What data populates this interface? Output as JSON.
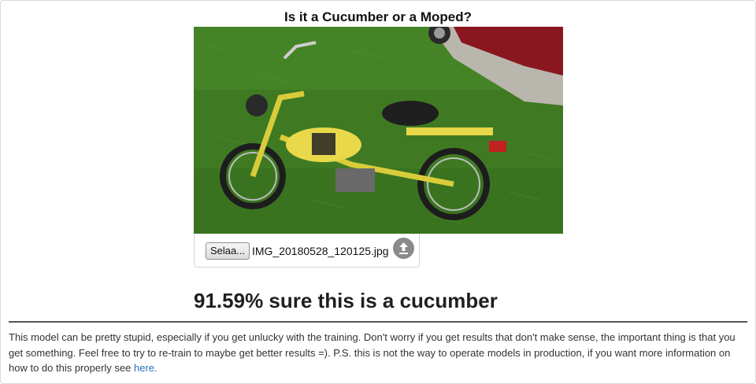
{
  "page": {
    "title": "Is it a Cucumber or a Moped?"
  },
  "uploader": {
    "choose_label": "Selaa...",
    "file_name": "IMG_20180528_120125.jpg",
    "upload_icon": "upload-icon"
  },
  "prediction": {
    "text": "91.59% sure this is a cucumber"
  },
  "note": {
    "text": "This model can be pretty stupid, especially if you get unlucky with the training. Don't worry if you get results that don't make sense, the important thing is that you get something. Feel free to try to re-train to maybe get better results =). P.S. this is not the way to operate models in production, if you want more information on how to do this properly see ",
    "link_label": "here."
  },
  "colors": {
    "grass": "#3f7a22",
    "moped_body": "#e8d84a",
    "link": "#2a6ebb",
    "divider": "#555555"
  }
}
